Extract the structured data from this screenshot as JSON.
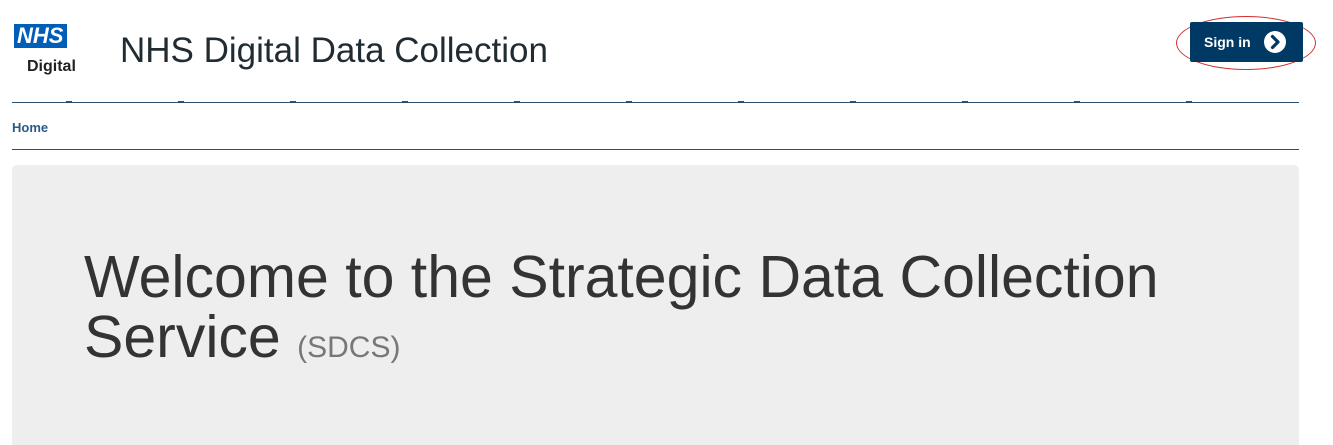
{
  "header": {
    "logo_mark": "NHS",
    "logo_sub": "Digital",
    "site_title": "NHS Digital Data Collection",
    "sign_in_label": "Sign in",
    "sign_in_icon": "chevron-right-circle-icon"
  },
  "nav": {
    "breadcrumb": [
      "Home"
    ]
  },
  "hero": {
    "title_line1": "Welcome to the Strategic Data Collection",
    "title_line2": "Service",
    "title_abbr": "(SDCS)"
  },
  "colors": {
    "nhs_blue": "#005eb8",
    "button_navy": "#003a64",
    "annotation_red": "#d32f2f",
    "hero_bg": "#eeeeee"
  }
}
